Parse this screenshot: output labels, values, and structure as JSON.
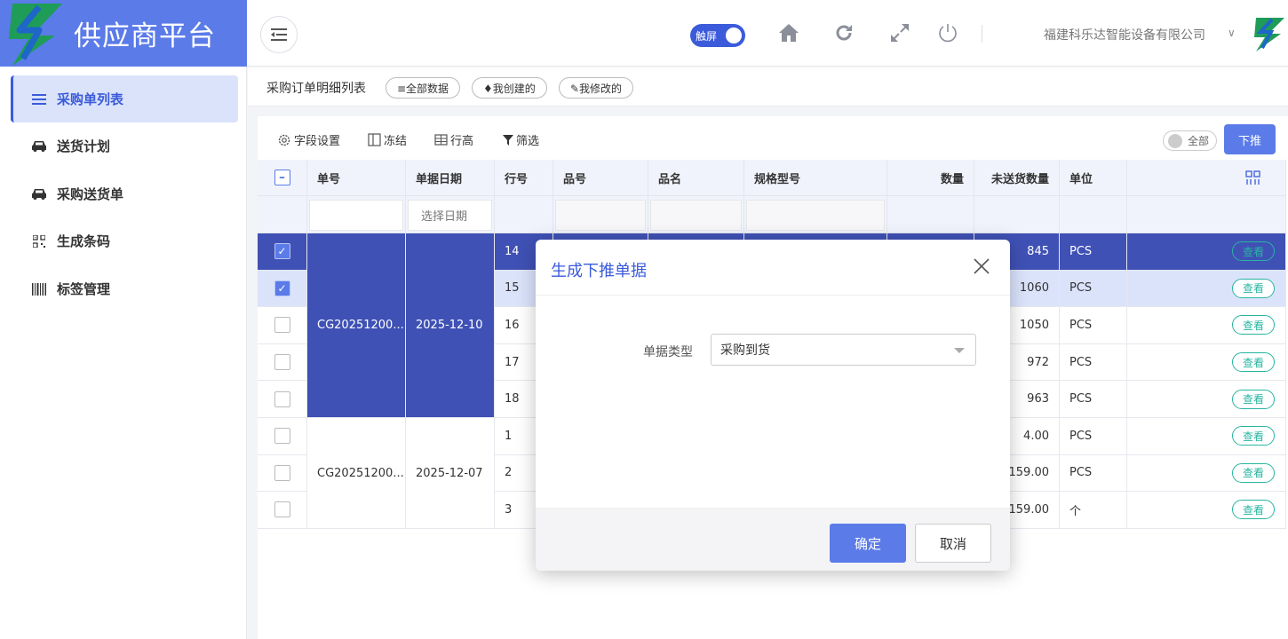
{
  "app": {
    "title": "供应商平台",
    "touch_label": "触屏",
    "company": "福建科乐达智能设备有限公司"
  },
  "sidebar": {
    "items": [
      {
        "label": "采购单列表",
        "icon": "list-icon",
        "active": true
      },
      {
        "label": "送货计划",
        "icon": "car-icon",
        "active": false
      },
      {
        "label": "采购送货单",
        "icon": "car-icon",
        "active": false
      },
      {
        "label": "生成条码",
        "icon": "qrcode-icon",
        "active": false
      },
      {
        "label": "标签管理",
        "icon": "barcode-icon",
        "active": false
      }
    ]
  },
  "subbar": {
    "title": "采购订单明细列表",
    "chips": [
      "≡全部数据",
      "♦我创建的",
      "✎我修改的"
    ]
  },
  "toolbar": {
    "field_settings": "字段设置",
    "freeze": "冻结",
    "row_height": "行高",
    "filter": "筛选",
    "all_toggle": "全部",
    "push_button": "下推"
  },
  "table": {
    "columns": [
      "单号",
      "单据日期",
      "行号",
      "品号",
      "品名",
      "规格型号",
      "数量",
      "未送货数量",
      "单位"
    ],
    "date_filter_placeholder": "选择日期",
    "groups": [
      {
        "order_no": "CG20251200...",
        "date": "2025-12-10"
      },
      {
        "order_no": "CG20251200...",
        "date": "2025-12-07"
      }
    ],
    "rows": [
      {
        "line": "14",
        "undelivered": "845",
        "unit": "PCS",
        "checked": true
      },
      {
        "line": "15",
        "undelivered": "1060",
        "unit": "PCS",
        "checked": true
      },
      {
        "line": "16",
        "undelivered": "1050",
        "unit": "PCS",
        "checked": false
      },
      {
        "line": "17",
        "undelivered": "972",
        "unit": "PCS",
        "checked": false
      },
      {
        "line": "18",
        "undelivered": "963",
        "unit": "PCS",
        "checked": false
      },
      {
        "line": "1",
        "undelivered": "4.00",
        "unit": "PCS",
        "checked": false
      },
      {
        "line": "2",
        "undelivered": "159.00",
        "unit": "PCS",
        "checked": false
      },
      {
        "line": "3",
        "undelivered": "159.00",
        "unit": "个",
        "checked": false
      }
    ],
    "view_label": "查看"
  },
  "dialog": {
    "title": "生成下推单据",
    "field_label": "单据类型",
    "field_value": "采购到货",
    "ok": "确定",
    "cancel": "取消"
  },
  "colors": {
    "primary": "#5b7be8",
    "selected_row": "#3f51b5",
    "highlight_row": "#dbe3fb",
    "view_button": "#27b5a0"
  }
}
